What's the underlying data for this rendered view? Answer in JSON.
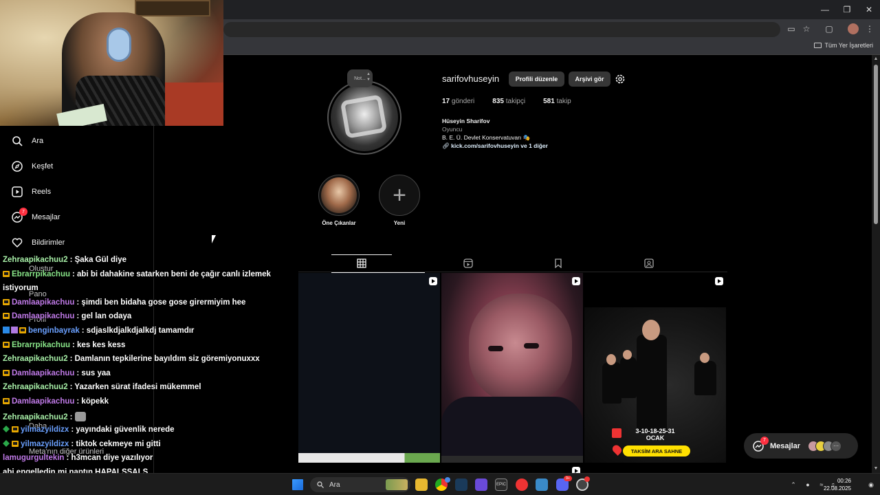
{
  "browser": {
    "bookmarks_all": "Tüm Yer İşaretleri"
  },
  "nav": {
    "items": [
      {
        "label": "Ara",
        "icon": "search-icon"
      },
      {
        "label": "Keşfet",
        "icon": "compass-icon"
      },
      {
        "label": "Reels",
        "icon": "reels-icon"
      },
      {
        "label": "Mesajlar",
        "icon": "messenger-icon",
        "badge": "7"
      },
      {
        "label": "Bildirimler",
        "icon": "heart-icon"
      }
    ],
    "faded_items": [
      "Oluştur",
      "Pano",
      "Profil",
      "Daha",
      "Meta'nın diğer ürünleri"
    ]
  },
  "profile": {
    "note": "Not...",
    "username": "sarifovhuseyin",
    "edit_button": "Profili düzenle",
    "archive_button": "Arşivi gör",
    "stats": {
      "posts_count": "17",
      "posts_label": "gönderi",
      "followers_count": "835",
      "followers_label": "takipçi",
      "following_count": "581",
      "following_label": "takip"
    },
    "bio": {
      "name": "Hüseyin Sharifov",
      "category": "Oyuncu",
      "line": "B. E. Ü. Devlet Konservatuvarı 🎭",
      "link": "kick.com/sarifovhuseyin ve 1 diğer"
    }
  },
  "highlights": [
    {
      "label": "Öne Çıkanlar"
    },
    {
      "label": "Yeni"
    }
  ],
  "post3": {
    "dates": "3-10-18-25-31",
    "month": "OCAK",
    "venue": "TAKSİM ARA SAHNE"
  },
  "messages_pill": {
    "label": "Mesajlar",
    "badge": "7"
  },
  "chat": [
    {
      "user": "Zehraapikachuu2",
      "color": "#a8f0a8",
      "text": ": Şaka Gül diye",
      "badge": ""
    },
    {
      "user": "Ebrarrpikachuu",
      "color": "#8ae88a",
      "text": ": abi bi dahakine satarken beni de çağır canlı izlemek",
      "badge": "crown"
    },
    {
      "user": "",
      "color": "#fff",
      "text": "istiyorum",
      "badge": ""
    },
    {
      "user": "Damlaapikachuu",
      "color": "#c07ae8",
      "text": ": şimdi ben bidaha gose gose girermiyim hee",
      "badge": "crown"
    },
    {
      "user": "Damlaapikachuu",
      "color": "#c07ae8",
      "text": ": gel lan odaya",
      "badge": "crown"
    },
    {
      "user": "benginbayrak",
      "color": "#6aa0ff",
      "text": ": sdjaslkdjalkdjalkdj tamamdır",
      "badge": "multi"
    },
    {
      "user": "Ebrarrpikachuu",
      "color": "#8ae88a",
      "text": ": kes kes kess",
      "badge": "crown"
    },
    {
      "user": "Zehraapikachuu2",
      "color": "#a8f0a8",
      "text": ": Damlanın tepkilerine bayıldım siz göremiyonuxxx",
      "badge": ""
    },
    {
      "user": "Damlaapikachuu",
      "color": "#c07ae8",
      "text": ": sus yaa",
      "badge": "crown"
    },
    {
      "user": "Zehraapikachuu2",
      "color": "#a8f0a8",
      "text": ": Yazarken sürat ifadesi mükemmel",
      "badge": ""
    },
    {
      "user": "Damlaapikachuu",
      "color": "#c07ae8",
      "text": ": köpekk",
      "badge": "crown"
    },
    {
      "user": "Zehraapikachuu2",
      "color": "#a8f0a8",
      "text": ":",
      "badge": "",
      "emote": true
    },
    {
      "user": "yilmazyildizx",
      "color": "#6aa0ff",
      "text": ": yayındaki güvenlik nerede",
      "badge": "gem"
    },
    {
      "user": "yilmazyildizx",
      "color": "#6aa0ff",
      "text": ": tiktok cekmeye mi gitti",
      "badge": "gem"
    },
    {
      "user": "lamugurgultekin",
      "color": "#c07ae8",
      "text": ": h3mcan diye yazılıyor",
      "badge": ""
    },
    {
      "user": "",
      "color": "#fff",
      "text": "abi engelledin mi naptın HAPALSŞALS",
      "badge": ""
    }
  ],
  "taskbar": {
    "search_label": "Ara",
    "time": "00:26",
    "date": "22.08.2025",
    "discord_badge": "9+"
  },
  "colors": {
    "badge": "#ff3040",
    "button_bg": "#363636",
    "pill_yellow": "#ffe000"
  }
}
